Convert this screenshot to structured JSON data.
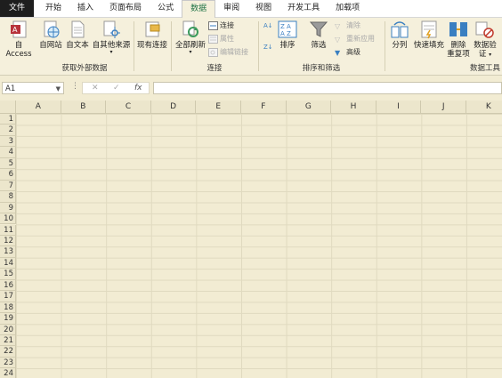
{
  "tabs": [
    "文件",
    "开始",
    "插入",
    "页面布局",
    "公式",
    "数据",
    "审阅",
    "视图",
    "开发工具",
    "加载项"
  ],
  "active_tab": "数据",
  "ribbon": {
    "external": {
      "label": "获取外部数据",
      "access": "自 Access",
      "web": "自网站",
      "text": "自文本",
      "other": "自其他来源",
      "existing": "现有连接"
    },
    "connections": {
      "label": "连接",
      "refresh_all": "全部刷新",
      "connections": "连接",
      "properties": "属性",
      "edit_links": "编辑链接"
    },
    "sortfilter": {
      "label": "排序和筛选",
      "sort": "排序",
      "filter": "筛选",
      "clear": "清除",
      "reapply": "重新应用",
      "advanced": "高级"
    },
    "datatools": {
      "label": "数据工具",
      "text_to_columns": "分列",
      "flash_fill": "快速填充",
      "remove_dup_1": "删除",
      "remove_dup_2": "重复项",
      "validation_1": "数据验",
      "validation_2": "证"
    }
  },
  "formula_bar": {
    "name_box": "A1",
    "value": ""
  },
  "columns": [
    "A",
    "B",
    "C",
    "D",
    "E",
    "F",
    "G",
    "H",
    "I",
    "J",
    "K"
  ],
  "rows": [
    "1",
    "2",
    "3",
    "4",
    "5",
    "6",
    "7",
    "8",
    "9",
    "10",
    "11",
    "12",
    "13",
    "14",
    "15",
    "16",
    "17",
    "18",
    "19",
    "20",
    "21",
    "22",
    "23",
    "24"
  ],
  "colors": {
    "accent": "#1f7345",
    "sheet_bg": "#f2ecd3"
  }
}
